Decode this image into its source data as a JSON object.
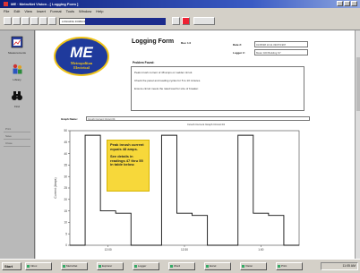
{
  "window": {
    "title": "ME · MetroNet Vision - [ Logging Form ]"
  },
  "menubar": [
    "File",
    "Edit",
    "View",
    "Insert",
    "Format",
    "Tools",
    "Window",
    "Help"
  ],
  "toolbar": {
    "address": "LOGGING FORM 00-01"
  },
  "sidebar": {
    "items": [
      {
        "label": "Measurements",
        "icon": "chart-window-icon"
      },
      {
        "label": "Library",
        "icon": "people-icon"
      },
      {
        "label": "Find",
        "icon": "binoculars-icon"
      }
    ],
    "links": [
      "Print",
      "Save",
      "Close"
    ]
  },
  "form": {
    "logo_letters": "ME",
    "logo_text_1": "Metropolitan",
    "logo_text_2": "Electrical",
    "title": "Logging Form",
    "rev_label": "Rev. 1.0",
    "date_label": "Date #:",
    "date_value": "01/05/98  10:11  09/07/1997",
    "logger_label": "Logger #:",
    "logger_value": "Meter 400  Building S7",
    "problem_label": "Problem Found:",
    "problem_lines": [
      "Peak inrush current of 48 amps on welder circuit.",
      "Check the panel and reading cycles for 5 to 10 minutes.",
      "Ensure circuit meets the rated load for size of breaker."
    ],
    "desc_label": "Graph Name:",
    "desc_value": "Inrush Current  Circuit 04"
  },
  "chart_data": {
    "type": "line",
    "title": "Inrush Current  Graph  Circuit 04",
    "ylabel": "Current (Amps)",
    "xlabel": "",
    "ylim": [
      0,
      50
    ],
    "yticks": [
      0,
      5,
      10,
      15,
      20,
      25,
      30,
      35,
      40,
      45,
      50
    ],
    "x": [
      0,
      2,
      4,
      6,
      8,
      10,
      12,
      14,
      16,
      18,
      20,
      22,
      24,
      26,
      28,
      30
    ],
    "xticks": [
      "12:00",
      "12:30",
      "1:00"
    ],
    "series": [
      {
        "values": [
          0,
          48,
          15,
          14,
          0,
          0,
          48,
          14,
          13,
          0,
          0,
          48,
          14,
          13,
          0,
          0
        ]
      }
    ],
    "grid": false,
    "annotations": [
      "Peak inrush current equals 48 amps.",
      "See details in readings 47 thru 55 in table below."
    ]
  },
  "taskbar": {
    "start": "Start",
    "tasks": [
      "Inbox",
      "MetroNet",
      "Explorer",
      "Logger",
      "Word",
      "Excel",
      "Vision",
      "Print"
    ],
    "clock": "11:05 AM"
  }
}
